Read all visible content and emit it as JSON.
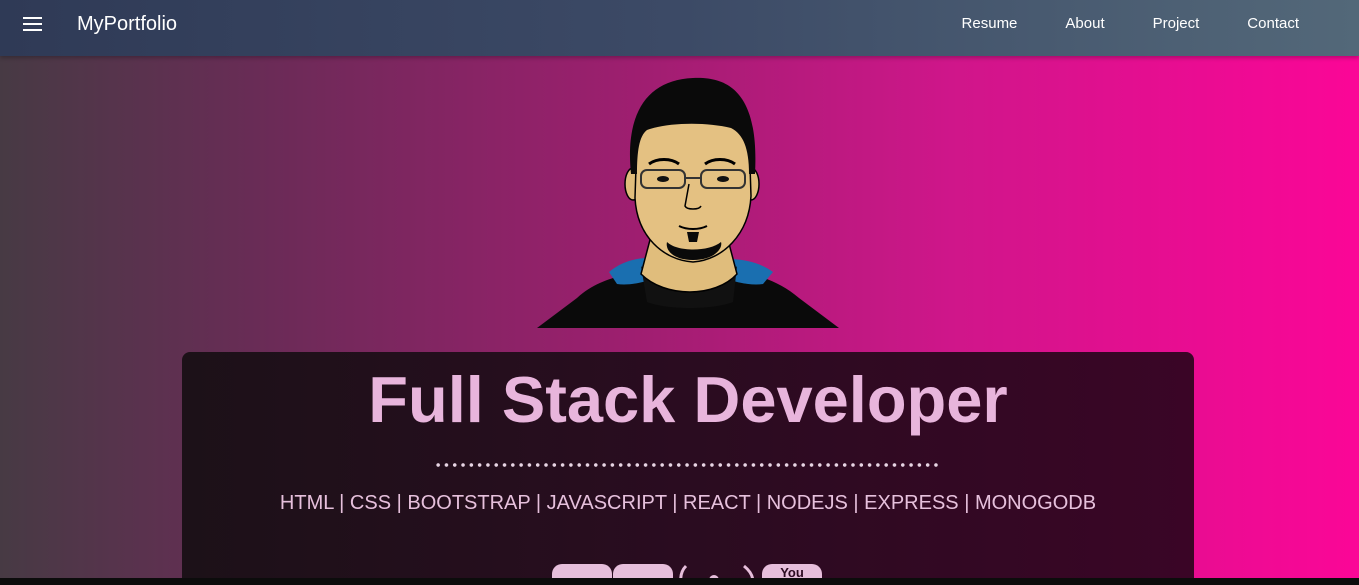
{
  "navbar": {
    "brand": "MyPortfolio",
    "links": [
      "Resume",
      "About",
      "Project",
      "Contact"
    ]
  },
  "hero": {
    "title": "Full Stack Developer",
    "skills": "HTML | CSS | BOOTSTRAP | JAVASCRIPT | REACT | NODEJS | EXPRESS | MONOGODB",
    "youtube_label": "You"
  },
  "colors": {
    "title": "#e8b5dc",
    "skills": "#e6c0dc",
    "nav_start": "#2f3a56",
    "nav_end": "#536879",
    "bg_end": "#fb0697"
  },
  "icons": [
    "menu-icon",
    "avatar-illustration",
    "linkedin-icon",
    "github-icon",
    "twitter-icon",
    "youtube-icon"
  ]
}
